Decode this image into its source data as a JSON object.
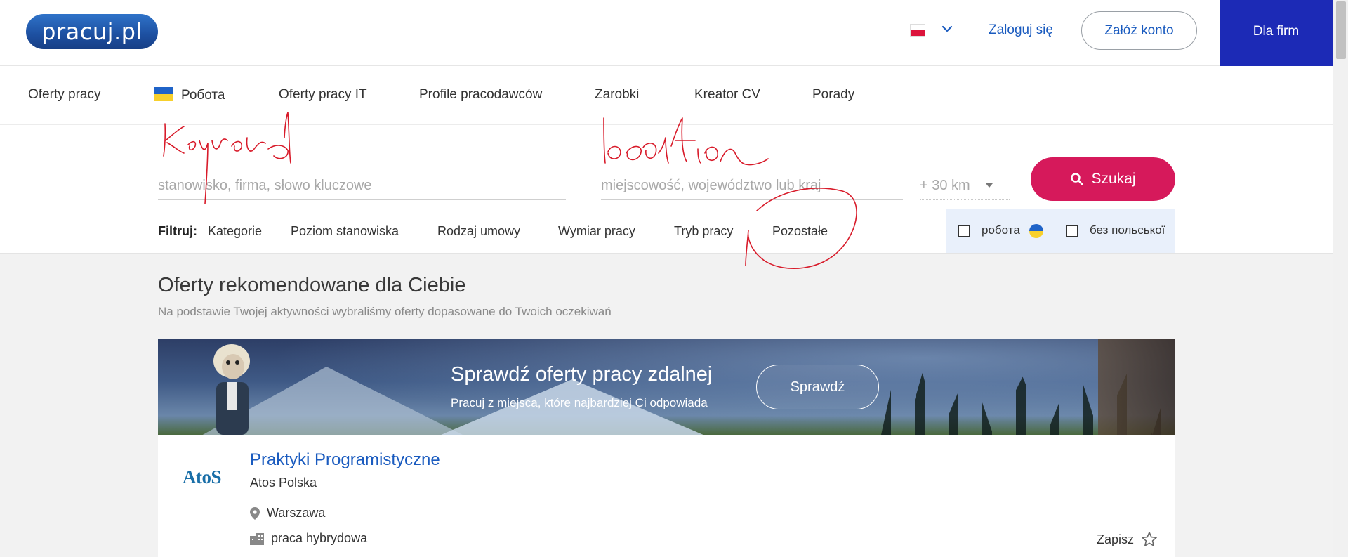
{
  "header": {
    "logo": "pracuj.pl",
    "login": "Zaloguj się",
    "register": "Załóż konto",
    "for_firms": "Dla firm"
  },
  "nav": {
    "items": [
      {
        "label": "Oferty pracy"
      },
      {
        "label": "Робота"
      },
      {
        "label": "Oferty pracy IT"
      },
      {
        "label": "Profile pracodawców"
      },
      {
        "label": "Zarobki"
      },
      {
        "label": "Kreator CV"
      },
      {
        "label": "Porady"
      }
    ]
  },
  "search": {
    "keyword_placeholder": "stanowisko, firma, słowo kluczowe",
    "location_placeholder": "miejscowość, województwo lub kraj",
    "distance": "+ 30 km",
    "button": "Szukaj"
  },
  "filters": {
    "label": "Filtruj:",
    "items": [
      "Kategorie",
      "Poziom stanowiska",
      "Rodzaj umowy",
      "Wymiar pracy",
      "Tryb pracy",
      "Pozostałe"
    ],
    "checkboxes": [
      {
        "label": "робота",
        "checked": false
      },
      {
        "label": "без польської",
        "checked": false
      }
    ]
  },
  "recommended": {
    "title": "Oferty rekomendowane dla Ciebie",
    "subtitle": "Na podstawie Twojej aktywności wybraliśmy oferty dopasowane do Twoich oczekiwań"
  },
  "banner": {
    "title": "Sprawdź oferty pracy zdalnej",
    "subtitle": "Pracuj z miejsca, które najbardziej Ci odpowiada",
    "button": "Sprawdź"
  },
  "job": {
    "logo_text": "AtoS",
    "title": "Praktyki Programistyczne",
    "company": "Atos Polska",
    "location": "Warszawa",
    "work_mode": "praca hybrydowa",
    "save": "Zapisz"
  },
  "colors": {
    "brand_blue": "#1a5bbf",
    "for_firms_bg": "#1c2ab6",
    "search_button": "#d6195b",
    "annotation": "#d81b2a"
  }
}
